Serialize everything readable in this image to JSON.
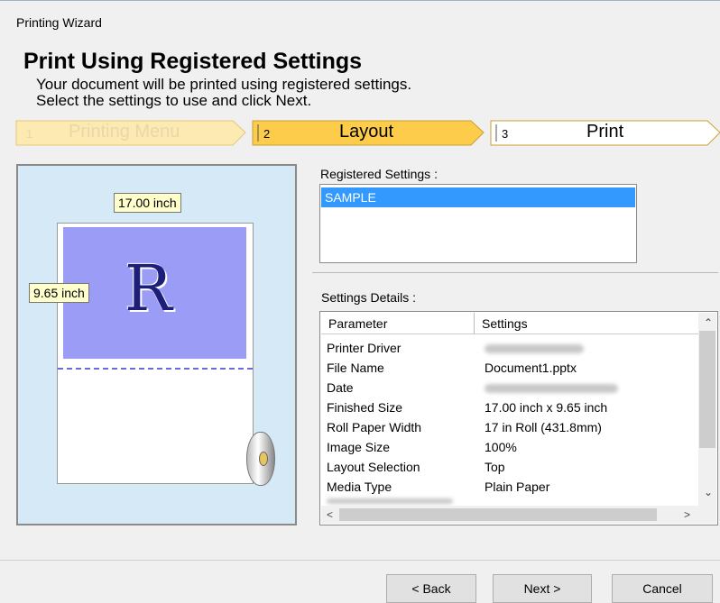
{
  "window_title": "Printing Wizard",
  "heading": "Print Using Registered Settings",
  "description": {
    "line1": "Your document will be printed using registered settings.",
    "line2": "Select the settings to use and click Next."
  },
  "steps": [
    {
      "num": "1",
      "label": "Printing Menu",
      "state": "done"
    },
    {
      "num": "2",
      "label": "Layout",
      "state": "active"
    },
    {
      "num": "3",
      "label": "Print",
      "state": "pending"
    }
  ],
  "preview": {
    "width_label": "17.00 inch",
    "height_label": "9.65 inch",
    "glyph": "R"
  },
  "registered_settings": {
    "label": "Registered Settings :",
    "items": [
      "SAMPLE"
    ],
    "selected": "SAMPLE"
  },
  "settings_details": {
    "label": "Settings Details :",
    "columns": [
      "Parameter",
      "Settings"
    ],
    "rows": [
      {
        "parameter": "Printer Driver",
        "value": ""
      },
      {
        "parameter": "File Name",
        "value": "Document1.pptx"
      },
      {
        "parameter": "Date",
        "value": ""
      },
      {
        "parameter": "Finished Size",
        "value": "17.00 inch x 9.65 inch"
      },
      {
        "parameter": "Roll Paper Width",
        "value": "17 in Roll (431.8mm)"
      },
      {
        "parameter": "Image Size",
        "value": "100%"
      },
      {
        "parameter": "Layout Selection",
        "value": "Top"
      },
      {
        "parameter": "Media Type",
        "value": "Plain Paper"
      }
    ]
  },
  "buttons": {
    "back": "< Back",
    "next": "Next >",
    "cancel": "Cancel"
  },
  "colors": {
    "step_active": "#fccc4a",
    "selection": "#3399ff",
    "print_area": "#9b9cf5",
    "preview_bg": "#d6e9f7"
  },
  "icons": [
    "scroll-up-icon",
    "scroll-down-icon",
    "scroll-left-icon",
    "scroll-right-icon"
  ]
}
